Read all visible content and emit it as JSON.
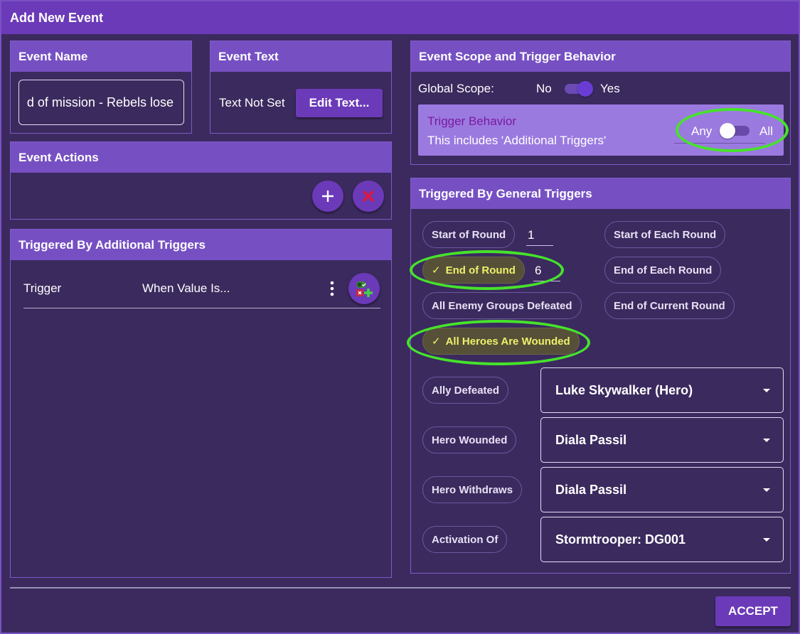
{
  "window": {
    "title": "Add New Event"
  },
  "event_name": {
    "heading": "Event Name",
    "value": "d of mission - Rebels lose"
  },
  "event_text": {
    "heading": "Event Text",
    "status": "Text Not Set",
    "edit_button": "Edit Text..."
  },
  "event_actions": {
    "heading": "Event Actions"
  },
  "additional_triggers": {
    "heading": "Triggered By Additional Triggers",
    "columns": [
      "Trigger",
      "When Value Is..."
    ]
  },
  "scope": {
    "heading": "Event Scope and Trigger Behavior",
    "global_label": "Global Scope:",
    "no_label": "No",
    "yes_label": "Yes",
    "global_scope": true,
    "trigger_behavior_title": "Trigger Behavior",
    "trigger_behavior_desc": "This includes 'Additional Triggers'",
    "any_label": "Any",
    "all_label": "All",
    "behavior_all": false
  },
  "general_triggers": {
    "heading": "Triggered By General Triggers",
    "chips": [
      {
        "label": "Start of Round",
        "selected": false,
        "value": "1"
      },
      {
        "label": "Start of Each Round",
        "selected": false
      },
      {
        "label": "End of Round",
        "selected": true,
        "value": "6"
      },
      {
        "label": "End of Each Round",
        "selected": false
      },
      {
        "label": "All Enemy Groups Defeated",
        "selected": false
      },
      {
        "label": "End of Current Round",
        "selected": false
      },
      {
        "label": "All Heroes Are Wounded",
        "selected": true
      }
    ],
    "selects": [
      {
        "label": "Ally Defeated",
        "value": "Luke Skywalker (Hero)"
      },
      {
        "label": "Hero Wounded",
        "value": "Diala Passil"
      },
      {
        "label": "Hero Withdraws",
        "value": "Diala Passil"
      },
      {
        "label": "Activation Of",
        "value": "Stormtrooper: DG001"
      }
    ]
  },
  "footer": {
    "accept": "ACCEPT"
  },
  "colors": {
    "title_bar": "#6b3ab8",
    "panel_header": "#7650c3",
    "background": "#3c2a5f",
    "selected_chip_text": "#eef06a",
    "highlight_ring": "#46e32b"
  }
}
